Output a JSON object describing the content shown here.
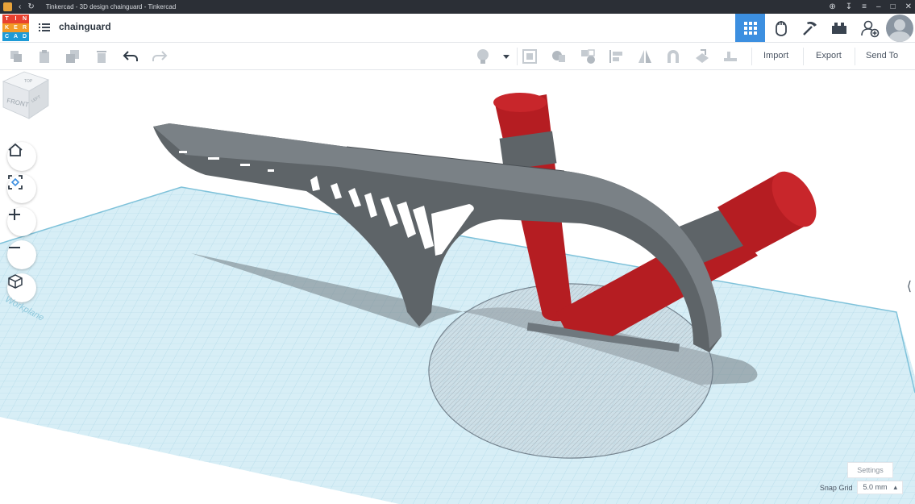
{
  "window": {
    "title": "Tinkercad - 3D design chainguard - Tinkercad",
    "controls": [
      "zoom",
      "download",
      "menu",
      "minimize",
      "maximize",
      "close"
    ]
  },
  "app": {
    "logo_letters": [
      "T",
      "I",
      "N",
      "K",
      "E",
      "R",
      "C",
      "A",
      "D"
    ],
    "logo_colors": [
      "#e8412f",
      "#e8412f",
      "#e8412f",
      "#f29a26",
      "#f29a26",
      "#f29a26",
      "#1d9ad6",
      "#1d9ad6",
      "#1d9ad6"
    ],
    "document_title": "chainguard",
    "header_buttons": [
      {
        "name": "3d-view-grid-icon",
        "active": true
      },
      {
        "name": "blocks-hand-icon",
        "active": false
      },
      {
        "name": "pickaxe-icon",
        "active": false
      },
      {
        "name": "bricks-icon",
        "active": false
      },
      {
        "name": "add-user-icon",
        "active": false
      }
    ],
    "accent_color": "#3c8fe0"
  },
  "toolbar": {
    "left_tools": [
      "copy-icon",
      "paste-icon",
      "duplicate-icon",
      "delete-icon",
      "undo-icon",
      "redo-icon"
    ],
    "right_tools": [
      "light-bulb-icon",
      "dropdown-caret-icon",
      "group-icon",
      "ungroup-icon",
      "align-icon",
      "flip-icon",
      "mirror-icon",
      "magnet-icon",
      "workplane-icon",
      "ruler-icon"
    ],
    "import_label": "Import",
    "export_label": "Export",
    "send_to_label": "Send To"
  },
  "viewport": {
    "view_cube": {
      "top": "TOP",
      "front": "FRONT",
      "left": "LEFT"
    },
    "nav_buttons": [
      "home-view-icon",
      "fit-view-icon",
      "zoom-in-icon",
      "zoom-out-icon",
      "perspective-icon"
    ],
    "workplane_label": "Workplane",
    "settings_label": "Settings",
    "snap_grid_label": "Snap Grid",
    "snap_grid_value": "5.0 mm",
    "shape_colors": {
      "guard": "#5e6468",
      "tube": "#b51d22",
      "hole": "#9aa3ab",
      "plane": "#d7eef6"
    }
  }
}
